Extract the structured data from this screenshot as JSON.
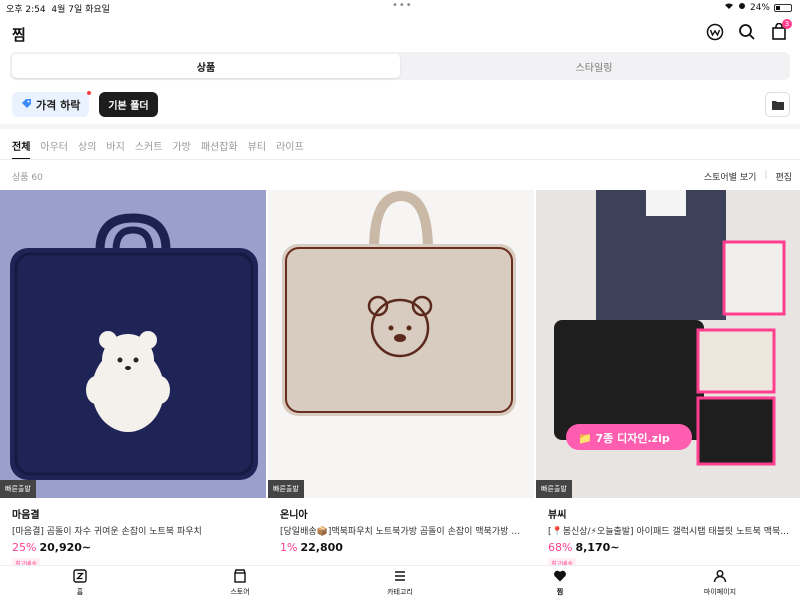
{
  "status": {
    "time": "오후 2:54",
    "date": "4월 7일 화요일",
    "battery": "24%"
  },
  "header": {
    "title": "찜",
    "cart_count": "3"
  },
  "segment": {
    "tabs": [
      "상품",
      "스타일링"
    ]
  },
  "chips": {
    "price_drop": "가격 하락",
    "folder": "기본 폴더"
  },
  "categories": [
    "전체",
    "아우터",
    "상의",
    "바지",
    "스커트",
    "가방",
    "패션잡화",
    "뷰티",
    "라이프"
  ],
  "count_label": "상품 60",
  "view_by_store": "스토어별 보기",
  "edit": "편집",
  "products": [
    {
      "fast": "빠른출발",
      "brand": "마음결",
      "name": "[마음결] 곰돌이 자수 귀여운 손잡이 노트북 파우치",
      "discount": "25%",
      "price": "20,920~",
      "tags": [
        "최고배송"
      ]
    },
    {
      "fast": "빠른출발",
      "brand": "온니아",
      "name": "[당일배송📦]맥북파우치 노트북가방 곰돌이 손잡이 맥북가방 종...",
      "discount": "1%",
      "price": "22,800",
      "tags": []
    },
    {
      "fast": "빠른출발",
      "brand": "뷰씨",
      "name": "[📍봄신상/⚡오늘출발] 아이패드 갤럭시탭 태블릿 노트북 맥북...",
      "discount": "68%",
      "price": "8,170~",
      "tags": [
        "최고배송"
      ],
      "overlay_text": "📁 7종 디자인.zip"
    }
  ],
  "bottom_nav": [
    "홈",
    "스토어",
    "카테고리",
    "찜",
    "마이페이지"
  ],
  "colors": {
    "accent": "#ff3e8f"
  }
}
